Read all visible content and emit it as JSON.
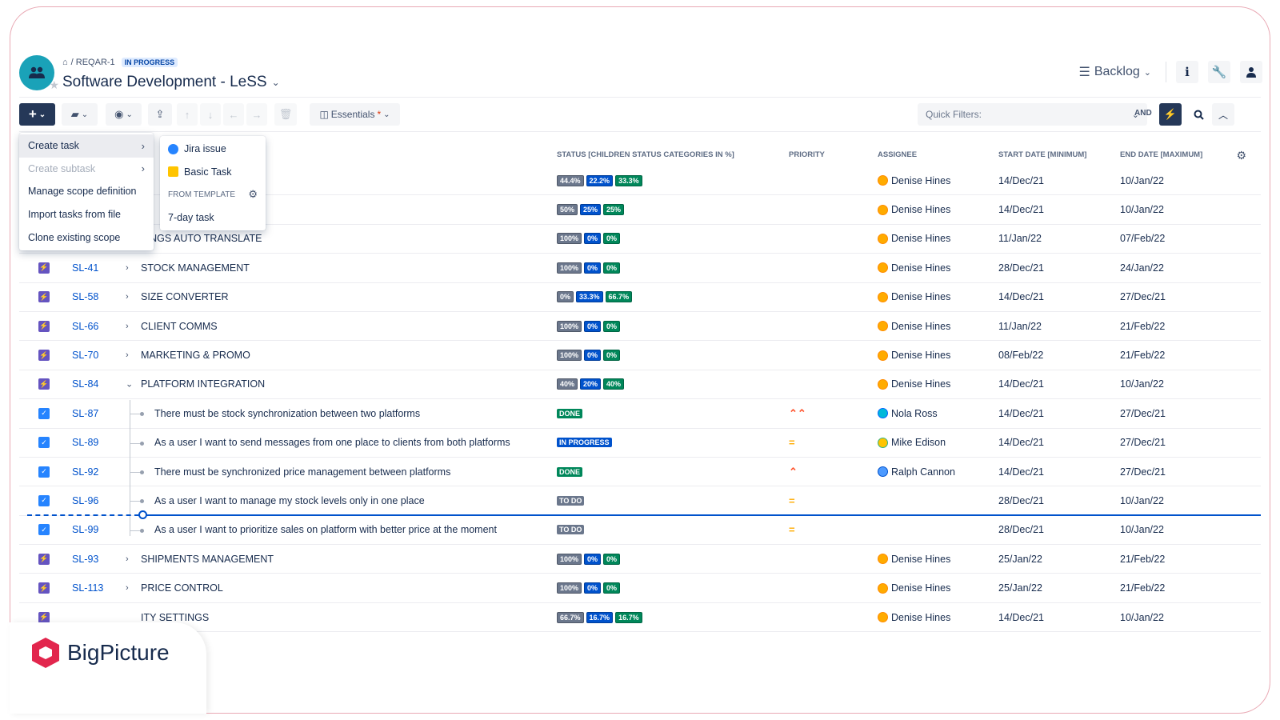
{
  "header": {
    "breadcrumb_key": "/ REQAR-1",
    "breadcrumb_status": "IN PROGRESS",
    "title": "Software Development - LeSS",
    "view_label": "Backlog"
  },
  "toolbar": {
    "view_preset": "Essentials",
    "view_preset_marker": "*",
    "quick_filters_placeholder": "Quick Filters:",
    "and_label": "AND"
  },
  "table": {
    "columns": {
      "status": "STATUS [CHILDREN STATUS CATEGORIES IN %]",
      "priority": "PRIORITY",
      "assignee": "ASSIGNEE",
      "start": "START DATE [MINIMUM]",
      "end": "END DATE [MAXIMUM]"
    },
    "rows": [
      {
        "type": "epic",
        "key": "",
        "summary": "",
        "expand": "",
        "status_pills": [
          "44.4%",
          "22.2%",
          "33.3%"
        ],
        "priority": "",
        "assignee": "Denise Hines",
        "start": "14/Dec/21",
        "end": "10/Jan/22"
      },
      {
        "type": "epic",
        "key": "",
        "summary": "",
        "expand": "",
        "status_pills": [
          "50%",
          "25%",
          "25%"
        ],
        "priority": "",
        "assignee": "Denise Hines",
        "start": "14/Dec/21",
        "end": "10/Jan/22"
      },
      {
        "type": "epic",
        "key": "",
        "summary": "TINGS AUTO TRANSLATE",
        "expand": "",
        "status_pills": [
          "100%",
          "0%",
          "0%"
        ],
        "priority": "",
        "assignee": "Denise Hines",
        "start": "11/Jan/22",
        "end": "07/Feb/22"
      },
      {
        "type": "epic",
        "key": "SL-41",
        "summary": "STOCK MANAGEMENT",
        "expand": ">",
        "status_pills": [
          "100%",
          "0%",
          "0%"
        ],
        "priority": "",
        "assignee": "Denise Hines",
        "start": "28/Dec/21",
        "end": "24/Jan/22"
      },
      {
        "type": "epic",
        "key": "SL-58",
        "summary": "SIZE CONVERTER",
        "expand": ">",
        "status_pills": [
          "0%",
          "33.3%",
          "66.7%"
        ],
        "priority": "",
        "assignee": "Denise Hines",
        "start": "14/Dec/21",
        "end": "27/Dec/21"
      },
      {
        "type": "epic",
        "key": "SL-66",
        "summary": "CLIENT COMMS",
        "expand": ">",
        "status_pills": [
          "100%",
          "0%",
          "0%"
        ],
        "priority": "",
        "assignee": "Denise Hines",
        "start": "11/Jan/22",
        "end": "21/Feb/22"
      },
      {
        "type": "epic",
        "key": "SL-70",
        "summary": "MARKETING & PROMO",
        "expand": ">",
        "status_pills": [
          "100%",
          "0%",
          "0%"
        ],
        "priority": "",
        "assignee": "Denise Hines",
        "start": "08/Feb/22",
        "end": "21/Feb/22"
      },
      {
        "type": "epic",
        "key": "SL-84",
        "summary": "PLATFORM INTEGRATION",
        "expand": "v",
        "status_pills": [
          "40%",
          "20%",
          "40%"
        ],
        "priority": "",
        "assignee": "Denise Hines",
        "start": "14/Dec/21",
        "end": "10/Jan/22"
      },
      {
        "type": "story",
        "key": "SL-87",
        "summary": "There must be stock synchronization between two platforms",
        "status": "DONE",
        "status_kind": "done",
        "priority": "highest",
        "assignee": "Nola Ross",
        "start": "14/Dec/21",
        "end": "27/Dec/21"
      },
      {
        "type": "story",
        "key": "SL-89",
        "summary": "As a user I want to send messages from one place to clients from both platforms",
        "status": "IN PROGRESS",
        "status_kind": "inprog",
        "priority": "medium",
        "assignee": "Mike Edison",
        "start": "14/Dec/21",
        "end": "27/Dec/21"
      },
      {
        "type": "story",
        "key": "SL-92",
        "summary": "There must be synchronized price management between platforms",
        "status": "DONE",
        "status_kind": "done",
        "priority": "high",
        "assignee": "Ralph Cannon",
        "start": "14/Dec/21",
        "end": "27/Dec/21"
      },
      {
        "type": "story",
        "key": "SL-96",
        "summary": "As a user I want to manage my stock levels only in one place",
        "status": "TO DO",
        "status_kind": "todo",
        "priority": "medium",
        "assignee": "",
        "start": "28/Dec/21",
        "end": "10/Jan/22"
      },
      {
        "type": "story",
        "key": "SL-99",
        "summary": "As a user I want to prioritize sales on platform with better price at the moment",
        "status": "TO DO",
        "status_kind": "todo",
        "priority": "medium",
        "assignee": "",
        "start": "28/Dec/21",
        "end": "10/Jan/22"
      },
      {
        "type": "epic",
        "key": "SL-93",
        "summary": "SHIPMENTS MANAGEMENT",
        "expand": ">",
        "status_pills": [
          "100%",
          "0%",
          "0%"
        ],
        "priority": "",
        "assignee": "Denise Hines",
        "start": "25/Jan/22",
        "end": "21/Feb/22"
      },
      {
        "type": "epic",
        "key": "SL-113",
        "summary": "PRICE CONTROL",
        "expand": ">",
        "status_pills": [
          "100%",
          "0%",
          "0%"
        ],
        "priority": "",
        "assignee": "Denise Hines",
        "start": "25/Jan/22",
        "end": "21/Feb/22"
      },
      {
        "type": "epic",
        "key": "",
        "summary": "ITY SETTINGS",
        "expand": "",
        "status_pills": [
          "66.7%",
          "16.7%",
          "16.7%"
        ],
        "priority": "",
        "assignee": "Denise Hines",
        "start": "14/Dec/21",
        "end": "10/Jan/22"
      }
    ]
  },
  "menus": {
    "main": [
      {
        "label": "Create task",
        "state": "active"
      },
      {
        "label": "Create subtask",
        "state": "disabled"
      },
      {
        "label": "Manage scope definition",
        "state": ""
      },
      {
        "label": "Import tasks from file",
        "state": ""
      },
      {
        "label": "Clone existing scope",
        "state": ""
      }
    ],
    "sub": {
      "jira_issue": "Jira issue",
      "basic_task": "Basic Task",
      "from_template": "FROM TEMPLATE",
      "template_item": "7-day task"
    }
  },
  "branding": {
    "logo_text": "BigPicture",
    "logo_color": "#e2264d"
  },
  "colors": {
    "primary_dark": "#253858",
    "link": "#0052cc",
    "epic": "#6554c0",
    "story": "#2684ff"
  }
}
